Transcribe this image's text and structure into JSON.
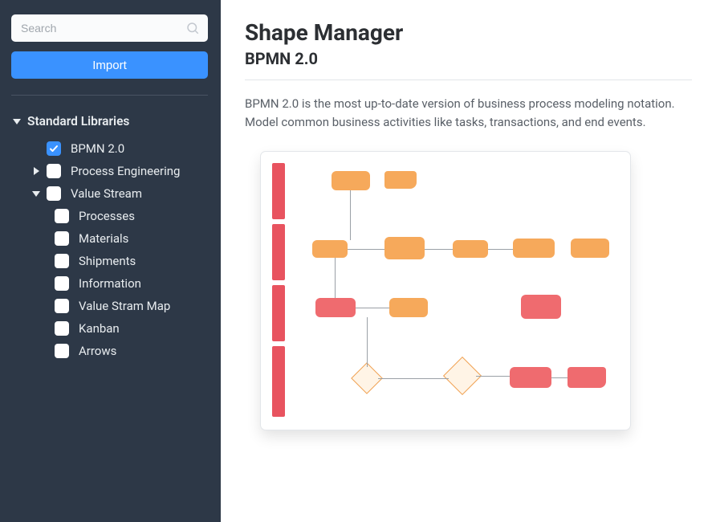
{
  "sidebar": {
    "search_placeholder": "Search",
    "import_label": "Import",
    "header": "Standard Libraries",
    "items": [
      {
        "label": "BPMN 2.0",
        "checked": true,
        "expandable": false,
        "expanded": false
      },
      {
        "label": "Process Engineering",
        "checked": false,
        "expandable": true,
        "expanded": false
      },
      {
        "label": "Value Stream",
        "checked": false,
        "expandable": true,
        "expanded": true,
        "children": [
          {
            "label": "Processes"
          },
          {
            "label": "Materials"
          },
          {
            "label": "Shipments"
          },
          {
            "label": "Information"
          },
          {
            "label": "Value Stram Map"
          },
          {
            "label": "Kanban"
          },
          {
            "label": "Arrows"
          }
        ]
      }
    ]
  },
  "main": {
    "title": "Shape Manager",
    "subtitle": "BPMN 2.0",
    "description": "BPMN 2.0 is the most up-to-date version of business process modeling notation. Model common business activities like tasks, transactions, and end events."
  }
}
